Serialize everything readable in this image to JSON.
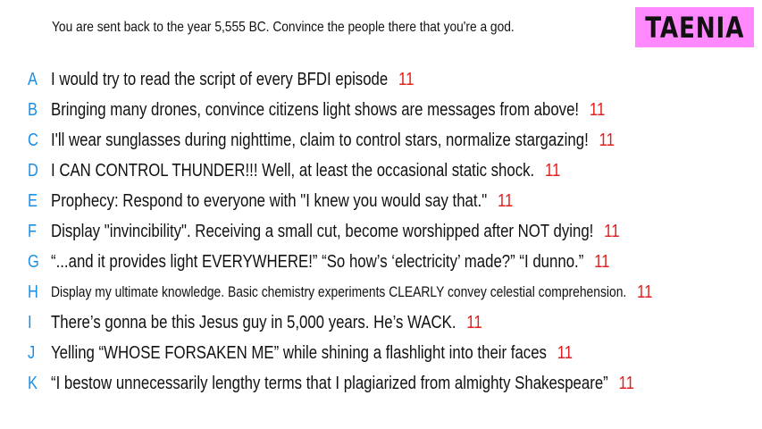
{
  "prompt": "You are sent back to the year 5,555 BC. Convince the people there that you're a god.",
  "contestant": "TAENIA",
  "colors": {
    "letter": "#1a8fe8",
    "score": "#e02020",
    "name_box": "#ff88ff",
    "text": "#111111"
  },
  "entries": [
    {
      "letter": "A",
      "text": "I would try to read the script of every BFDI episode",
      "score": "11"
    },
    {
      "letter": "B",
      "text": "Bringing many drones, convince citizens light shows are messages from above!",
      "score": "11"
    },
    {
      "letter": "C",
      "text": "I'll wear sunglasses during nighttime, claim to control stars, normalize stargazing!",
      "score": "11"
    },
    {
      "letter": "D",
      "text": "I CAN CONTROL THUNDER!!! Well, at least the occasional static shock.",
      "score": "11"
    },
    {
      "letter": "E",
      "text": "Prophecy: Respond to everyone with \"I knew you would say that.\"",
      "score": "11"
    },
    {
      "letter": "F",
      "text": "Display \"invincibility\". Receiving a small cut, become worshipped after NOT dying!",
      "score": "11"
    },
    {
      "letter": "G",
      "text": "“...and it provides light EVERYWHERE!” “So how’s ‘electricity’ made?” “I dunno.”",
      "score": "11"
    },
    {
      "letter": "H",
      "text": "Display my ultimate knowledge. Basic chemistry experiments CLEARLY convey celestial comprehension.",
      "score": "11"
    },
    {
      "letter": "I",
      "text": "There’s gonna be this Jesus guy in 5,000 years. He’s WACK.",
      "score": "11"
    },
    {
      "letter": "J",
      "text": "Yelling “WHOSE FORSAKEN ME” while shining a flashlight into their faces",
      "score": "11"
    },
    {
      "letter": "K",
      "text": "“I bestow unnecessarily lengthy terms that I plagiarized from almighty Shakespeare”",
      "score": "11"
    }
  ]
}
